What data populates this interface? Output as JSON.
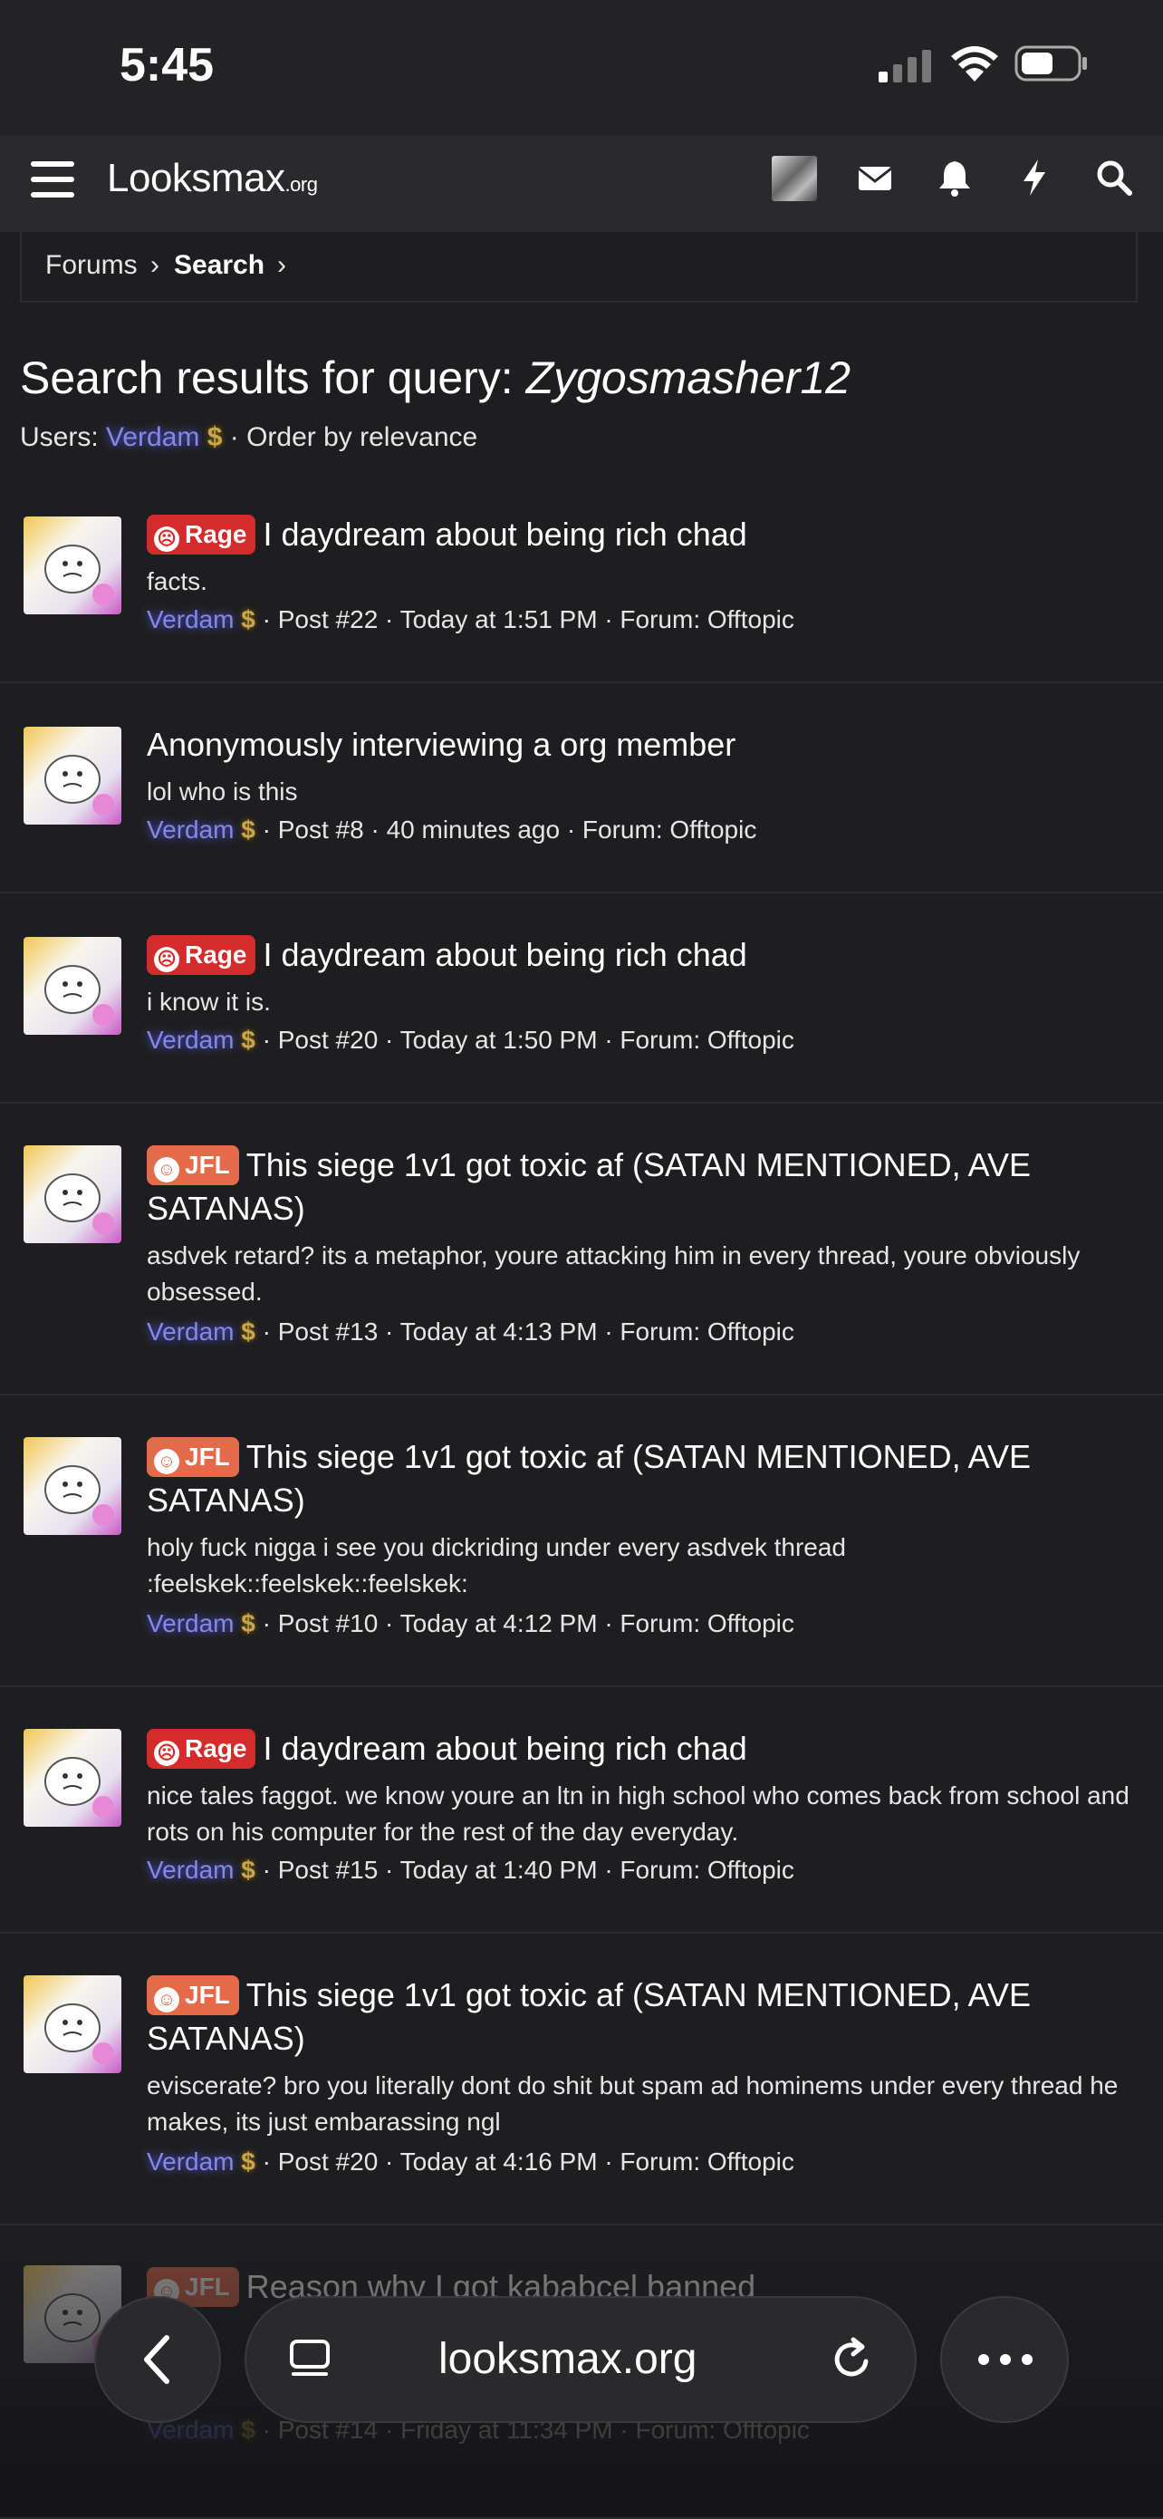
{
  "status_bar": {
    "time": "5:45"
  },
  "header": {
    "logo_main": "Looksmax",
    "logo_tld": ".org"
  },
  "breadcrumb": {
    "forums": "Forums",
    "search": "Search"
  },
  "search": {
    "title_prefix": "Search results for query: ",
    "query": "Zygosmasher12",
    "users_label": "Users: ",
    "user": "Verdam",
    "order": " · Order by relevance"
  },
  "results": [
    {
      "prefix": "Rage",
      "title": "I daydream about being rich chad",
      "snippet": "facts.",
      "user": "Verdam",
      "meta": " · Post #22 · Today at 1:51 PM · Forum: Offtopic"
    },
    {
      "prefix": "",
      "title": "Anonymously interviewing a org member",
      "snippet": "lol who is this",
      "user": "Verdam",
      "meta": " · Post #8 · 40 minutes ago · Forum: Offtopic"
    },
    {
      "prefix": "Rage",
      "title": "I daydream about being rich chad",
      "snippet": "i know it is.",
      "user": "Verdam",
      "meta": " · Post #20 · Today at 1:50 PM · Forum: Offtopic"
    },
    {
      "prefix": "JFL",
      "title": "This siege 1v1 got toxic af (SATAN MENTIONED, AVE SATANAS)",
      "snippet": "asdvek retard? its a metaphor, youre attacking him in every thread, youre obviously obsessed.",
      "user": "Verdam",
      "meta": " · Post #13 · Today at 4:13 PM · Forum: Offtopic"
    },
    {
      "prefix": "JFL",
      "title": "This siege 1v1 got toxic af (SATAN MENTIONED, AVE SATANAS)",
      "snippet": "holy fuck nigga i see you dickriding under every asdvek thread :feelskek::feelskek::feelskek:",
      "user": "Verdam",
      "meta": " · Post #10 · Today at 4:12 PM · Forum: Offtopic"
    },
    {
      "prefix": "Rage",
      "title": "I daydream about being rich chad",
      "snippet": "nice tales faggot. we know youre an ltn in high school who comes back from school and rots on his computer for the rest of the day everyday.",
      "user": "Verdam",
      "meta": " · Post #15 · Today at 1:40 PM · Forum: Offtopic"
    },
    {
      "prefix": "JFL",
      "title": "This siege 1v1 got toxic af (SATAN MENTIONED, AVE SATANAS)",
      "snippet": "eviscerate? bro you literally dont do shit but spam ad hominems under every thread he makes, its just embarassing ngl",
      "user": "Verdam",
      "meta": " · Post #20 · Today at 4:16 PM · Forum: Offtopic"
    },
    {
      "prefix": "JFL",
      "title": "Reason why I got kababcel banned",
      "snippet": "",
      "user": "Verdam",
      "meta": " · Post #14 · Friday at 11:34 PM · Forum: Offtopic"
    }
  ],
  "browser": {
    "url": "looksmax.org"
  },
  "colors": {
    "background": "#1e1e20",
    "username": "#8589e6",
    "rage_badge": "#d52b2b",
    "jfl_badge": "#e46a4a",
    "dollar": "#c9a64a"
  },
  "icons": [
    "hamburger-icon",
    "mail-icon",
    "bell-icon",
    "bolt-icon",
    "search-icon",
    "back-arrow-icon",
    "tabs-icon",
    "reload-icon",
    "more-icon",
    "dollar-icon",
    "angry-face-icon",
    "laughing-face-icon"
  ]
}
